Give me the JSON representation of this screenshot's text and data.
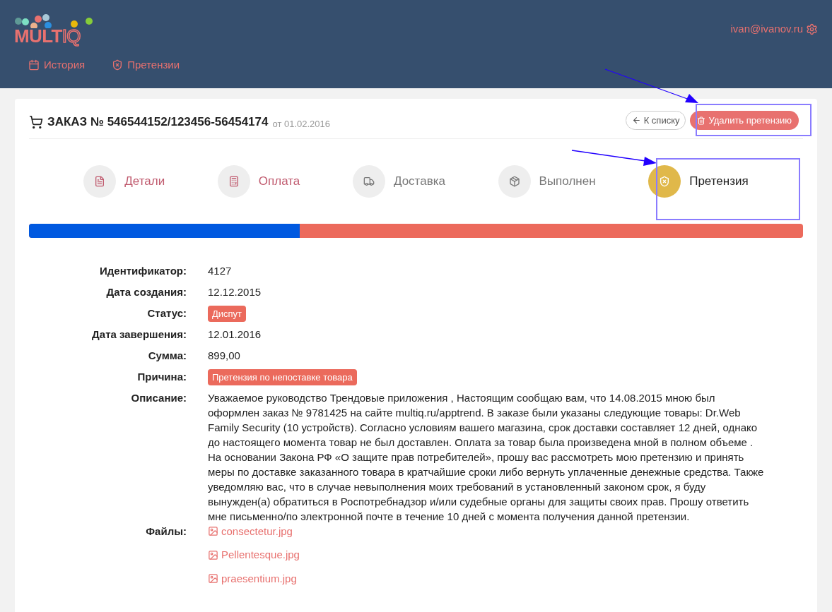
{
  "logo": {
    "main": "MULT",
    "suffix": "IQ"
  },
  "user": {
    "email": "ivan@ivanov.ru"
  },
  "nav": [
    {
      "label": "История"
    },
    {
      "label": "Претензии"
    }
  ],
  "order": {
    "title": "ЗАКАЗ № 546544152/123456-56454174",
    "date": "от 01.02.2016"
  },
  "buttons": {
    "back": "К списку",
    "delete": "Удалить претензию"
  },
  "steps": [
    {
      "label": "Детали",
      "kind": "done",
      "selected": false
    },
    {
      "label": "Оплата",
      "kind": "done",
      "selected": false
    },
    {
      "label": "Доставка",
      "kind": "pending",
      "selected": false
    },
    {
      "label": "Выполнен",
      "kind": "pending",
      "selected": false
    },
    {
      "label": "Претензия",
      "kind": "pending",
      "selected": true
    }
  ],
  "progress": {
    "level": 0.35
  },
  "fields": [
    {
      "label": "Идентификатор:",
      "kind": "text",
      "value": "4127"
    },
    {
      "label": "Дата создания:",
      "kind": "text",
      "value": "12.12.2015"
    },
    {
      "label": "Статус:",
      "kind": "tag",
      "value": "Диспут"
    },
    {
      "label": "Дата завершения:",
      "kind": "text",
      "value": "12.01.2016"
    },
    {
      "label": "Сумма:",
      "kind": "text",
      "value": "899,00"
    },
    {
      "label": "Причина:",
      "kind": "tag",
      "value": "Претензия по непоставке товара"
    },
    {
      "label": "Описание:",
      "kind": "text",
      "value": "Уважаемое руководство Трендовые приложения , Настоящим сообщаю вам, что 14.08.2015 мною был оформлен заказ № 9781425 на сайте multiq.ru/apptrend. В заказе были указаны следующие товары: Dr.Web Family Security (10 устройств). Согласно условиям вашего магазина, срок доставки составляет 12 дней, однако до настоящего момента товар не был доставлен. Оплата за товар была произведена мной в полном объеме . На основании Закона РФ «О защите прав потребителей», прошу вас рассмотреть мою претензию и принять меры по доставке заказанного товара в кратчайшие сроки либо вернуть уплаченные денежные средства. Также уведомляю вас, что в случае невыполнения моих требований в установленный законом срок, я буду вынужден(а) обратиться в Роспотребнадзор и/или судебные органы для защиты своих прав. Прошу ответить мне письменно/по электронной почте в течение 10 дней с момента получения данной претензии."
    },
    {
      "label": "Файлы:",
      "kind": "files",
      "files": [
        "consectetur.jpg",
        "Pellentesque.jpg",
        "praesentium.jpg"
      ]
    }
  ]
}
